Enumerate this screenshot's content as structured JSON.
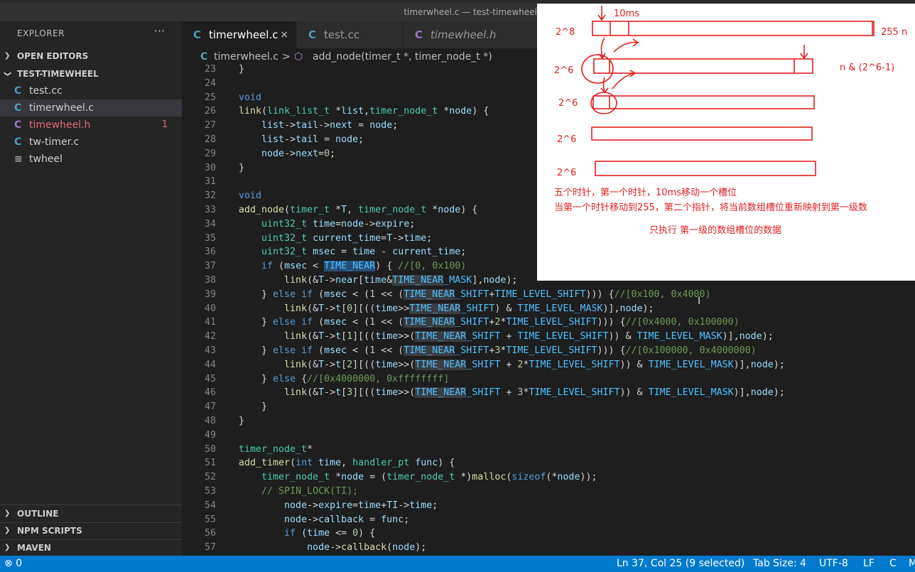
{
  "window": {
    "title": "timerwheel.c — test-timewheel"
  },
  "explorer": {
    "title": "EXPLORER",
    "more": "···",
    "open_editors": "OPEN EDITORS",
    "workspace": "TEST-TIMEWHEEL",
    "files": [
      {
        "icon": "C",
        "name": "test.cc",
        "badge": ""
      },
      {
        "icon": "C",
        "name": "timerwheel.c",
        "badge": ""
      },
      {
        "icon": "C",
        "name": "timewheel.h",
        "badge": "1"
      },
      {
        "icon": "C",
        "name": "tw-timer.c",
        "badge": ""
      },
      {
        "icon": "≡",
        "name": "twheel",
        "badge": ""
      }
    ],
    "outline": "OUTLINE",
    "npm": "NPM SCRIPTS",
    "maven": "MAVEN"
  },
  "tabs": [
    {
      "icon": "C",
      "label": "timerwheel.c",
      "close": "×"
    },
    {
      "icon": "C",
      "label": "test.cc"
    },
    {
      "icon": "C",
      "label": "timewheel.h"
    }
  ],
  "breadcrumb": {
    "file": "timerwheel.c",
    "sep": ">",
    "symbol": "add_node(timer_t *, timer_node_t *)"
  },
  "code": {
    "line_numbers": [
      "23",
      "24",
      "25",
      "26",
      "27",
      "28",
      "29",
      "30",
      "31",
      "32",
      "33",
      "34",
      "35",
      "36",
      "37",
      "38",
      "39",
      "40",
      "41",
      "42",
      "43",
      "44",
      "45",
      "46",
      "47",
      "48",
      "49",
      "50",
      "51",
      "52",
      "53",
      "54",
      "55",
      "56",
      "57"
    ]
  },
  "overlay": {
    "label_10ms": "10ms",
    "label_255n": "255 n",
    "row_labels": [
      "2^8",
      "2^6",
      "2^6",
      "2^6",
      "2^6"
    ],
    "mask_label": "n & (2^6-1)",
    "note1": "五个时针，第一个时针，10ms移动一个槽位",
    "note2": "当第一个时针移动到255，第二个指针，将当前数组槽位重新映射到第一级数",
    "note3": "只执行 第一级的数组槽位的数据",
    "ink_color": "#e02020"
  },
  "status": {
    "left": "⊗ 0",
    "position": "Ln 37, Col 25 (9 selected)",
    "tab_size": "Tab Size: 4",
    "encoding": "UTF-8",
    "eol": "LF",
    "lang": "C",
    "more": "M"
  }
}
